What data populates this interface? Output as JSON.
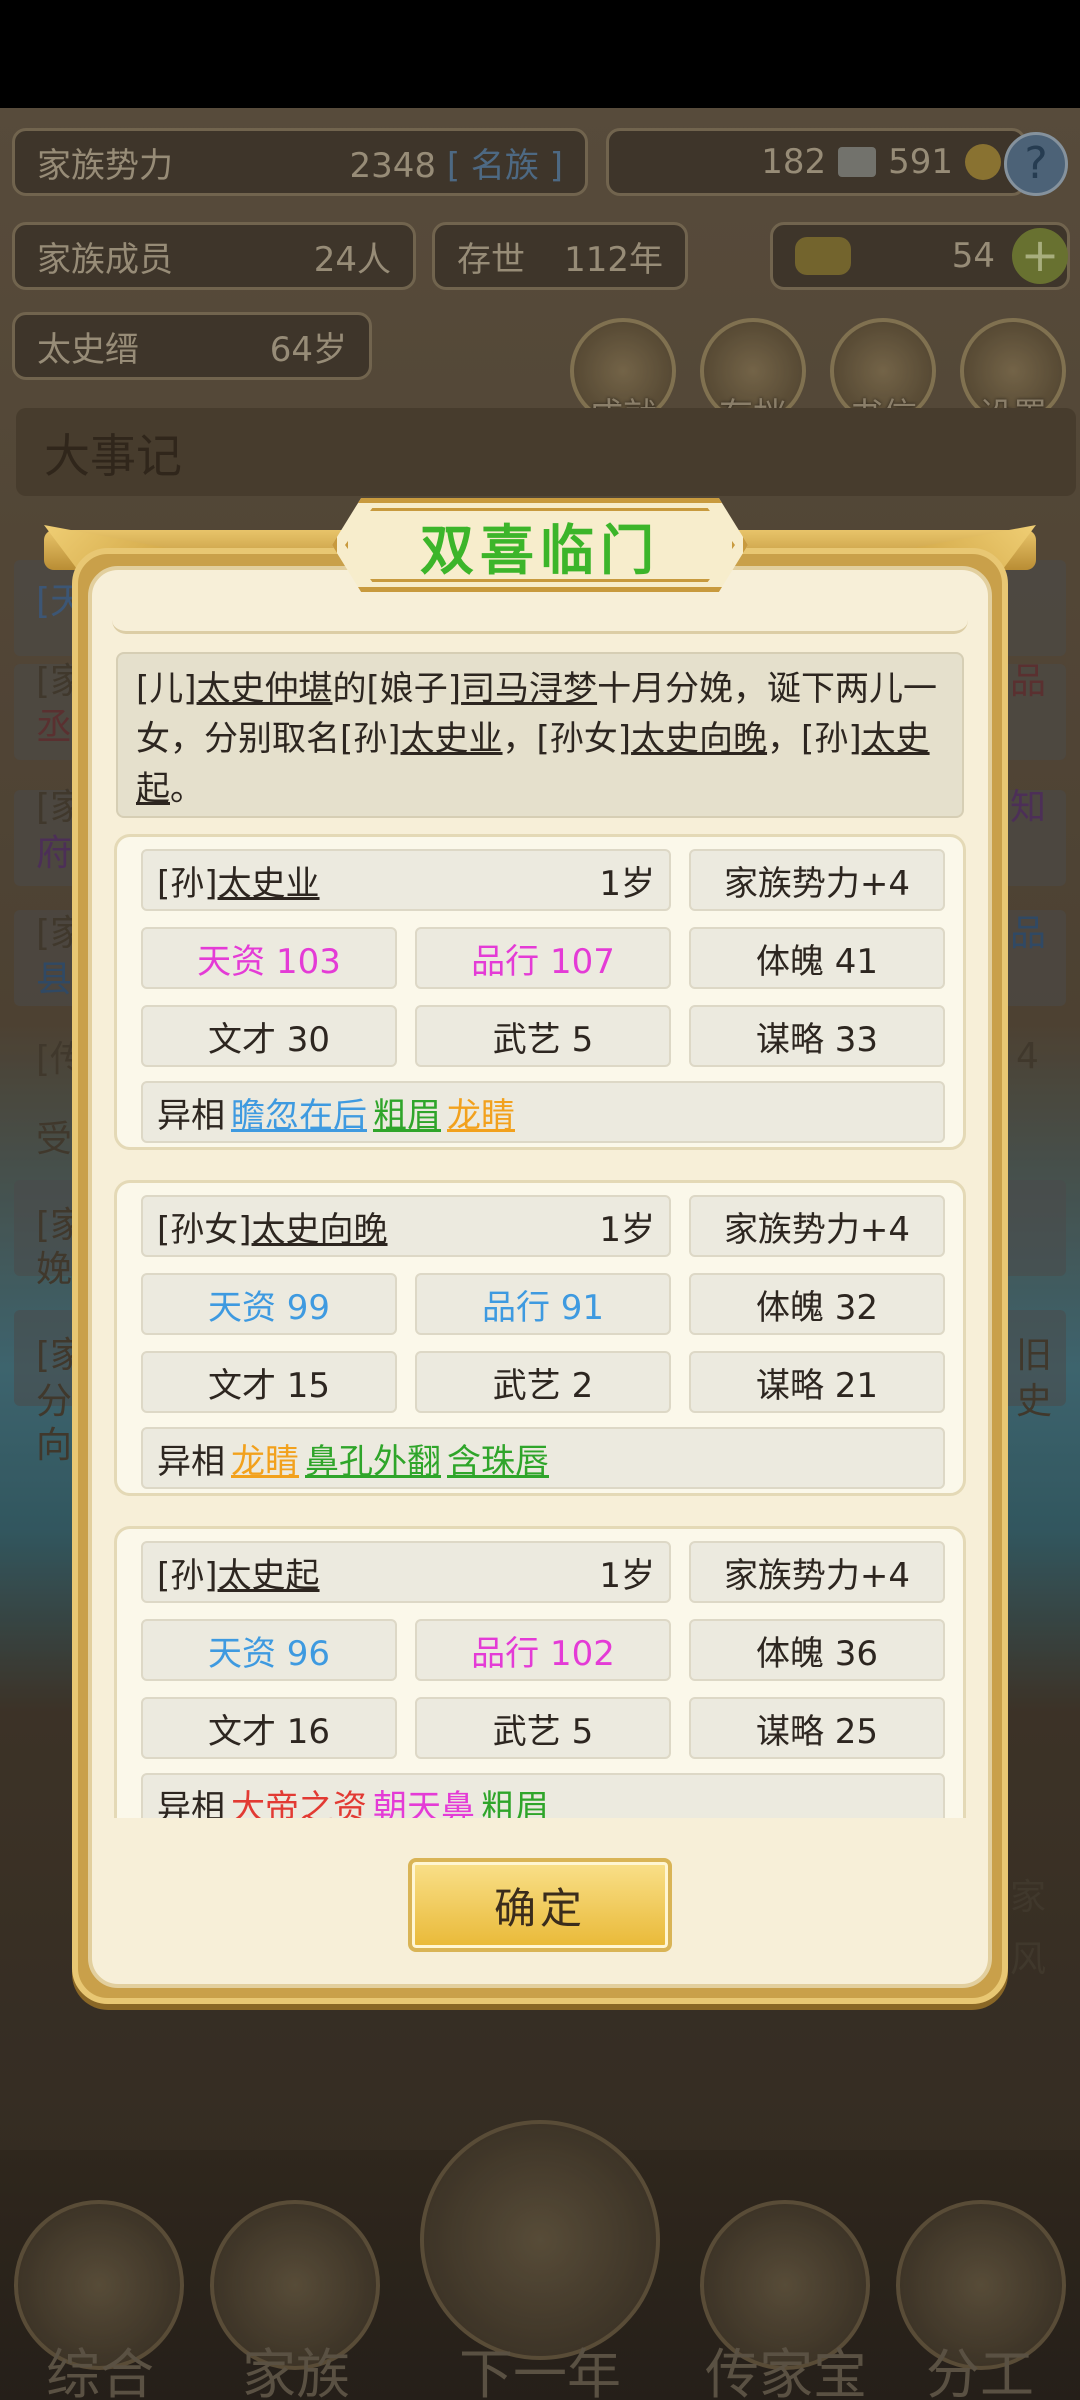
{
  "top": {
    "family_power_label": "家族势力",
    "family_power_value": "2348",
    "family_power_rank": "[ 名族 ]",
    "silver": "182",
    "coins": "591",
    "members_label": "家族成员",
    "members_value": "24人",
    "age_label": "存世",
    "age_value": "112年",
    "gold": "54",
    "leader_name": "太史缙",
    "leader_age": "64岁"
  },
  "menu": [
    "成就",
    "存档",
    "书信",
    "设置"
  ],
  "event_bar_title": "大事记",
  "background_fragments": [
    "[天",
    "[家",
    "丞",
    "[家",
    "府",
    "[家",
    "县",
    "[传",
    "受",
    "[家",
    "娩",
    "[家",
    "分",
    "向",
    "品",
    "知",
    "品",
    "4",
    "旧",
    "史",
    "家",
    "风"
  ],
  "bottom_nav": [
    "综合",
    "家族",
    "下一年",
    "传家宝",
    "分工"
  ],
  "dialog": {
    "title": "双喜临门",
    "narration": {
      "p1": "[儿]",
      "u1": "太史仲堪",
      "p2": "的[娘子]",
      "u2": "司马浔梦",
      "p3": "十月分娩，诞下两儿一女，分别取名[孙]",
      "u3": "太史业",
      "p4": "，[孙女]",
      "u4": "太史向晚",
      "p5": "，[孙]",
      "u5": "太史起",
      "p6": "。"
    },
    "confirm": "确定",
    "children": [
      {
        "rel": "[孙]",
        "name": "太史业",
        "age": "1岁",
        "power": "家族势力+4",
        "talent": "天资 103",
        "talent_color": "#e43bd6",
        "morality": "品行 107",
        "morality_color": "#e43bd6",
        "physique": "体魄 41",
        "literacy": "文才 30",
        "martial": "武艺 5",
        "strategy": "谋略 33",
        "traits_label": "异相",
        "traits": [
          {
            "text": "瞻忽在后",
            "color": "#3e9ae0"
          },
          {
            "text": "粗眉",
            "color": "#2fa52a"
          },
          {
            "text": "龙睛",
            "color": "#f2a11d"
          }
        ]
      },
      {
        "rel": "[孙女]",
        "name": "太史向晚",
        "age": "1岁",
        "power": "家族势力+4",
        "talent": "天资 99",
        "talent_color": "#3e9ae0",
        "morality": "品行 91",
        "morality_color": "#3e9ae0",
        "physique": "体魄 32",
        "literacy": "文才 15",
        "martial": "武艺 2",
        "strategy": "谋略 21",
        "traits_label": "异相",
        "traits": [
          {
            "text": "龙睛",
            "color": "#f2a11d"
          },
          {
            "text": "鼻孔外翻",
            "color": "#2fa52a"
          },
          {
            "text": "含珠唇",
            "color": "#2fa52a"
          }
        ]
      },
      {
        "rel": "[孙]",
        "name": "太史起",
        "age": "1岁",
        "power": "家族势力+4",
        "talent": "天资 96",
        "talent_color": "#3e9ae0",
        "morality": "品行 102",
        "morality_color": "#e43bd6",
        "physique": "体魄 36",
        "literacy": "文才 16",
        "martial": "武艺 5",
        "strategy": "谋略 25",
        "traits_label": "异相",
        "traits": [
          {
            "text": "大帝之资",
            "color": "#e23a33"
          },
          {
            "text": "朝天鼻",
            "color": "#e43bd6"
          },
          {
            "text": "粗眉",
            "color": "#2fa52a"
          }
        ]
      }
    ]
  }
}
